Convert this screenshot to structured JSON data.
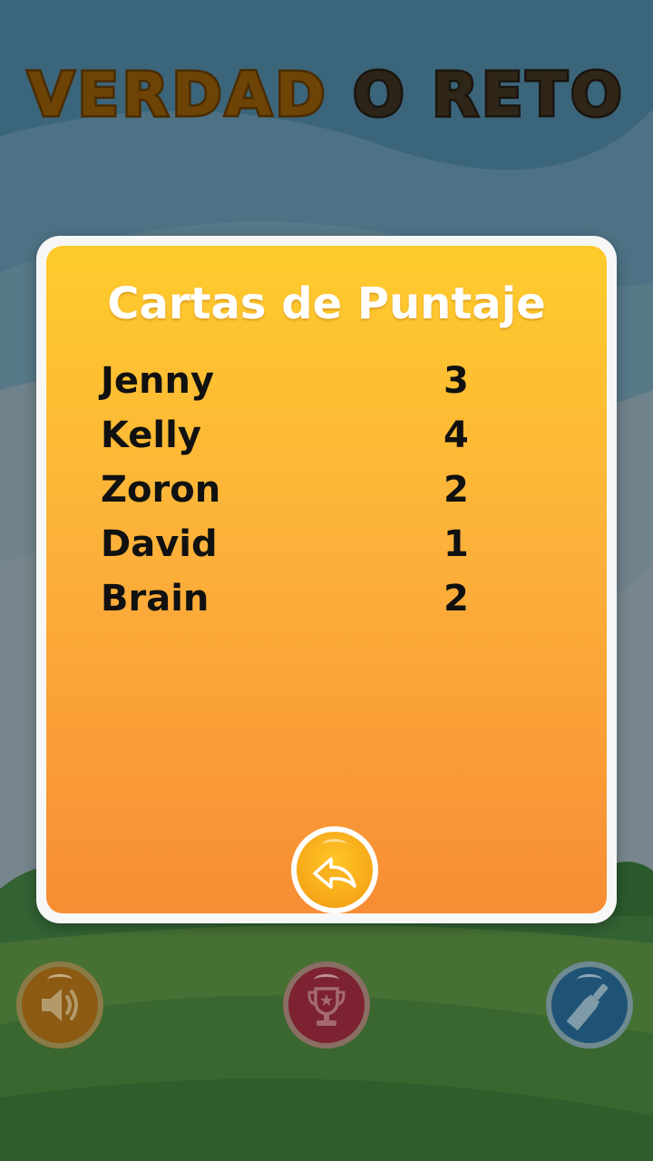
{
  "header": {
    "title_word1": "VERDAD",
    "title_word2": "O",
    "title_word3": "RETO"
  },
  "scorecard": {
    "title": "Cartas de Puntaje",
    "players": [
      {
        "name": "Jenny",
        "score": "3"
      },
      {
        "name": "Kelly",
        "score": "4"
      },
      {
        "name": "Zoron",
        "score": "2"
      },
      {
        "name": "David",
        "score": "1"
      },
      {
        "name": "Brain",
        "score": "2"
      }
    ]
  },
  "buttons": {
    "back": {
      "icon": "back-arrow-icon"
    },
    "sound": {
      "icon": "speaker-icon"
    },
    "trophy": {
      "icon": "trophy-icon"
    },
    "bottle": {
      "icon": "bottle-icon"
    }
  },
  "colors": {
    "card_top": "#ffcb2c",
    "card_bottom": "#f78d34",
    "title_verdad": "#6d4405",
    "title_reto": "#2f2618"
  }
}
